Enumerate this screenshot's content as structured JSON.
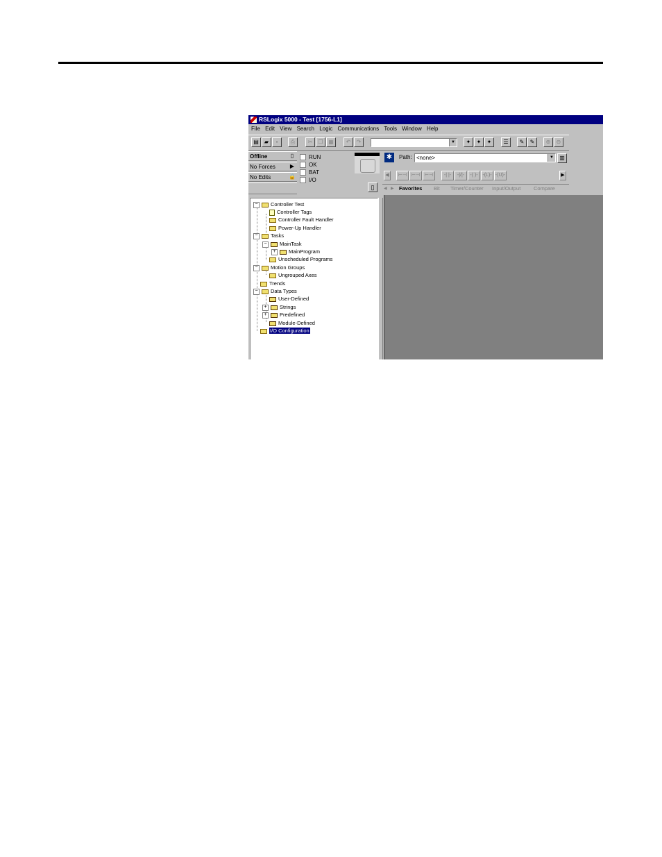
{
  "window": {
    "title": "RSLogix 5000 - Test [1756-L1]"
  },
  "menu": [
    "File",
    "Edit",
    "View",
    "Search",
    "Logic",
    "Communications",
    "Tools",
    "Window",
    "Help"
  ],
  "toolbar": {
    "icons": [
      "new-file-icon",
      "open-file-icon",
      "save-icon",
      "print-icon",
      "cut-icon",
      "copy-icon",
      "paste-icon",
      "undo-icon",
      "redo-icon",
      "find-combo",
      "verify-icon",
      "verify-all-icon",
      "verify-routine-icon",
      "properties-icon",
      "edit-icon",
      "zoom-in-icon",
      "zoom-out-icon"
    ],
    "search_value": ""
  },
  "status": {
    "mode": "Offline",
    "forces": "No Forces",
    "edits": "No Edits",
    "indicators": [
      "RUN",
      "OK",
      "BAT",
      "I/O"
    ]
  },
  "path": {
    "label": "Path:",
    "value": "<none>"
  },
  "instruction_tabs": [
    "Favorites",
    "Bit",
    "Timer/Counter",
    "Input/Output",
    "Compare"
  ],
  "tree": {
    "controller": "Controller Test",
    "controller_tags": "Controller Tags",
    "fault_handler": "Controller Fault Handler",
    "powerup_handler": "Power-Up Handler",
    "tasks": "Tasks",
    "main_task": "MainTask",
    "main_program": "MainProgram",
    "unscheduled": "Unscheduled Programs",
    "motion_groups": "Motion Groups",
    "ungrouped_axes": "Ungrouped Axes",
    "trends": "Trends",
    "data_types": "Data Types",
    "user_defined": "User-Defined",
    "strings": "Strings",
    "predefined": "Predefined",
    "module_defined": "Module-Defined",
    "io_config": "I/O Configuration"
  }
}
